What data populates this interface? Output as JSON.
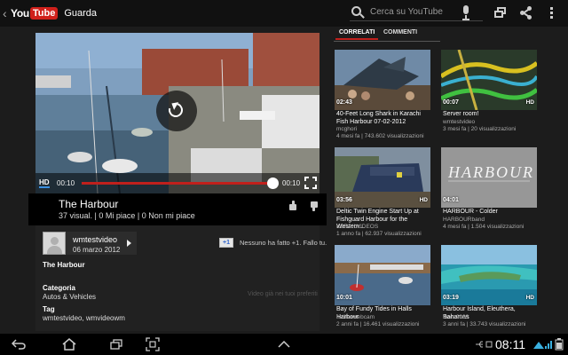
{
  "topbar": {
    "logo_you": "You",
    "logo_tube": "Tube",
    "title": "Guarda",
    "search_placeholder": "Cerca su YouTube"
  },
  "player": {
    "hd_label": "HD",
    "current_time": "00:10",
    "duration": "00:10",
    "progress": 1.0
  },
  "video": {
    "title": "The Harbour",
    "stats": "37 visual. | 0 Mi piace | 0 Non mi piace"
  },
  "channel": {
    "name": "wmtestvideo",
    "date": "06 marzo 2012"
  },
  "plusone": {
    "badge": "+1",
    "text": "Nessuno ha fatto +1. Fallo tu."
  },
  "description": {
    "title": "The Harbour",
    "category_label": "Categoria",
    "category_value": "Autos & Vehicles",
    "tag_label": "Tag",
    "tag_value": "wmtestvideo, wmvideowm",
    "fav_note": "Video già nei tuoi preferiti"
  },
  "tabs": {
    "related": "CORRELATI",
    "comments": "COMMENTI"
  },
  "related": [
    {
      "duration": "02:43",
      "hd": "",
      "title": "40-Feet Long Shark in Karachi Fish Harbour 07-02-2012",
      "channel": "mcghori",
      "meta": "4 mesi fa | 743.602 visualizzazioni"
    },
    {
      "duration": "00:07",
      "hd": "HD",
      "title": "Server room!",
      "channel": "wmtestvideo",
      "meta": "3 mesi fa | 20 visualizzazioni"
    },
    {
      "duration": "03:56",
      "hd": "HD",
      "title": "Deltic Twin Engine Start Up at Fishguard Harbour for the Western...",
      "channel": "KBRAILVIDEOS",
      "meta": "1 anno fa | 62.937 visualizzazioni"
    },
    {
      "duration": "04:01",
      "hd": "",
      "title": "HARBOUR - Colder",
      "channel": "HARBOURband",
      "meta": "4 mesi fa | 1.504 visualizzazioni"
    },
    {
      "duration": "10:01",
      "hd": "",
      "title": "Bay of Fundy Tides in Halls Harbour",
      "channel": "halifaxwebcam",
      "meta": "2 anni fa | 16.461 visualizzazioni"
    },
    {
      "duration": "03:19",
      "hd": "HD",
      "title": "Harbour Island, Eleuthera, Bahamas",
      "channel": "thore2009",
      "meta": "3 anni fa | 33.743 visualizzazioni"
    }
  ],
  "harbour_thumb_text": "HARBOUR",
  "status": {
    "clock": "08:11"
  },
  "colors": {
    "accent_red": "#c0201c",
    "background": "#1c1c1c",
    "hd_blue": "#3a8fe0"
  }
}
